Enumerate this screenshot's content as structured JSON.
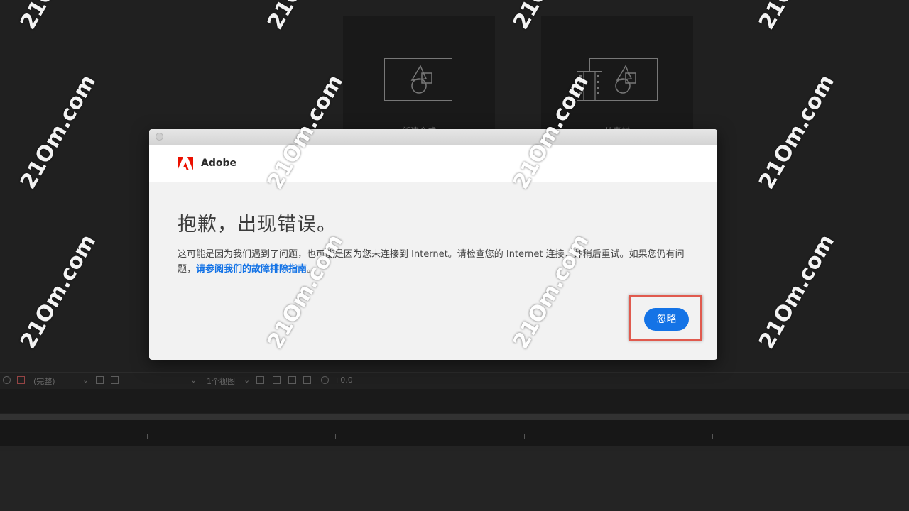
{
  "background": {
    "tiles": [
      {
        "label": "新建合成"
      },
      {
        "label": "从素材"
      }
    ],
    "toolbar": {
      "resolution": "(完整)",
      "views": "1个视图",
      "exposure": "+0.0"
    }
  },
  "dialog": {
    "brand": "Adobe",
    "heading": "抱歉，出现错误。",
    "message_part1": "这可能是因为我们遇到了问题，也可能是因为您未连接到 Internet。请检查您的 Internet 连接，并稍后重试。如果您仍有问题，",
    "message_link": "请参阅我们的故障排除指南",
    "message_end": "。",
    "ignore_label": "忽略"
  },
  "watermark": {
    "text": "21Om.com"
  },
  "colors": {
    "accent": "#1473e6",
    "adobe_red": "#eb1000",
    "highlight": "#e05a4e"
  }
}
